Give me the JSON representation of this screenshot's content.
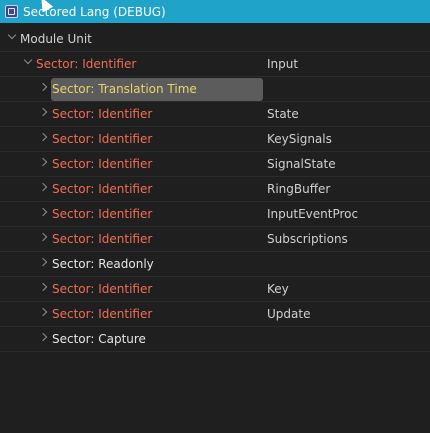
{
  "window": {
    "title": "Sectored Lang (DEBUG)"
  },
  "tree": {
    "root": {
      "label": "Module Unit"
    },
    "sector": {
      "label": "Sector: Identifier",
      "value": "Input"
    },
    "children": [
      {
        "label": "Sector: Translation Time",
        "value": "",
        "style": "yellow",
        "selected": true
      },
      {
        "label": "Sector: Identifier",
        "value": "State",
        "style": "red"
      },
      {
        "label": "Sector: Identifier",
        "value": "KeySignals",
        "style": "red"
      },
      {
        "label": "Sector: Identifier",
        "value": "SignalState",
        "style": "red"
      },
      {
        "label": "Sector: Identifier",
        "value": "RingBuffer",
        "style": "red"
      },
      {
        "label": "Sector: Identifier",
        "value": "InputEventProc",
        "style": "red"
      },
      {
        "label": "Sector: Identifier",
        "value": "Subscriptions",
        "style": "red"
      },
      {
        "label": "Sector: Readonly",
        "value": "",
        "style": "white"
      },
      {
        "label": "Sector: Identifier",
        "value": "Key",
        "style": "red"
      },
      {
        "label": "Sector: Identifier",
        "value": "Update",
        "style": "red"
      },
      {
        "label": "Sector: Capture",
        "value": "",
        "style": "white"
      }
    ]
  },
  "colors": {
    "titlebar": "#1fa3c8",
    "background": "#1f1f1f",
    "identifier": "#ef6e55",
    "translation_time": "#e8d46a",
    "selection": "#5c5c5c"
  }
}
